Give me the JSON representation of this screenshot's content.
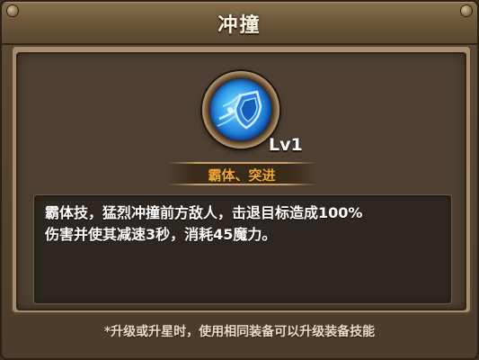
{
  "window": {
    "title": "冲撞"
  },
  "skill": {
    "icon": "blue-shield-skill-icon",
    "level": "Lv1",
    "tags": "霸体、突进",
    "description_line1": "霸体技，猛烈冲撞前方敌人，击退目标造成100%",
    "description_line2": "伤害并使其减速3秒，消耗45魔力。"
  },
  "footer": {
    "note": "*升级或升星时，使用相同装备可以升级装备技能"
  },
  "colors": {
    "tag_orange": "#f0a830",
    "icon_blue": "#3aa8f0",
    "frame_brown": "#5b4a36"
  }
}
